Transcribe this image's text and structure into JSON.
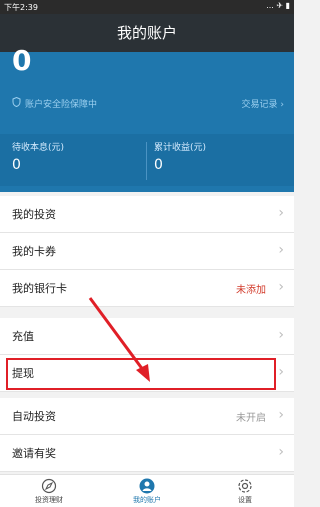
{
  "status": {
    "time": "下午2:39",
    "icons": "... ✈ ▮"
  },
  "title": "我的账户",
  "hero": {
    "balance": "0",
    "security": "账户安全险保障中",
    "records": "交易记录 ›"
  },
  "earnings": [
    {
      "label": "待收本息(元)",
      "value": "0"
    },
    {
      "label": "累计收益(元)",
      "value": "0"
    }
  ],
  "groups": [
    {
      "items": [
        {
          "label": "我的投资",
          "aux": ""
        },
        {
          "label": "我的卡券",
          "aux": ""
        },
        {
          "label": "我的银行卡",
          "aux": "未添加"
        }
      ]
    },
    {
      "items": [
        {
          "label": "充值",
          "aux": ""
        },
        {
          "label": "提现",
          "aux": ""
        }
      ]
    },
    {
      "items": [
        {
          "label": "自动投资",
          "aux": "未开启"
        },
        {
          "label": "邀请有奖",
          "aux": ""
        }
      ]
    }
  ],
  "tabs": [
    {
      "label": "投资理财",
      "icon": "compass-icon"
    },
    {
      "label": "我的账户",
      "icon": "user-icon"
    },
    {
      "label": "设置",
      "icon": "gear-icon"
    }
  ],
  "colors": {
    "accent": "#1f77ad",
    "header": "#2b3136",
    "annotation": "#e01f27",
    "warning": "#d23a2a"
  }
}
